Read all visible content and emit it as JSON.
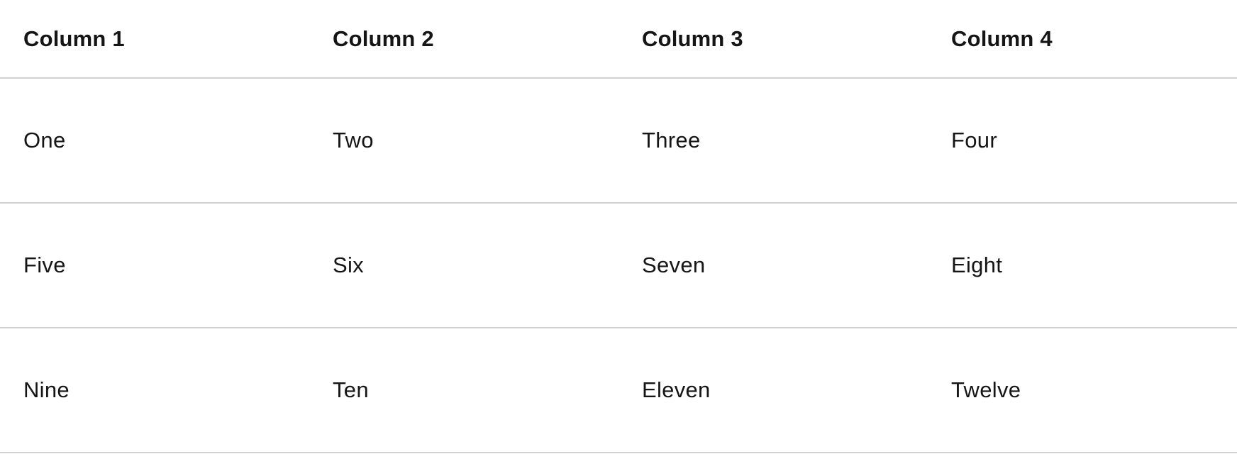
{
  "table": {
    "columns": [
      "Column 1",
      "Column 2",
      "Column 3",
      "Column 4"
    ],
    "rows": [
      [
        "One",
        "Two",
        "Three",
        "Four"
      ],
      [
        "Five",
        "Six",
        "Seven",
        "Eight"
      ],
      [
        "Nine",
        "Ten",
        "Eleven",
        "Twelve"
      ]
    ]
  }
}
